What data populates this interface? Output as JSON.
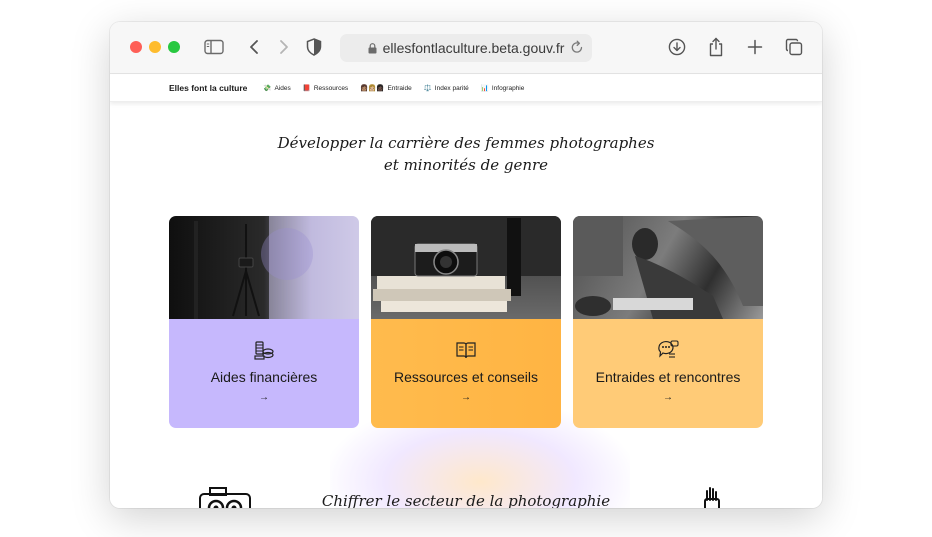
{
  "browser": {
    "url": "ellesfontlaculture.beta.gouv.fr",
    "icons": [
      "sidebar-icon",
      "back-icon",
      "forward-icon",
      "shield-icon",
      "lock-icon",
      "reload-icon",
      "download-icon",
      "share-icon",
      "new-tab-icon",
      "tabs-icon"
    ]
  },
  "nav": {
    "brand": "Elles font la culture",
    "items": [
      {
        "emoji": "💸",
        "label": "Aides"
      },
      {
        "emoji": "📕",
        "label": "Ressources"
      },
      {
        "emoji": "👩🏽👩🏼👩🏿",
        "label": "Entraide"
      },
      {
        "emoji": "⚖️",
        "label": "Index parité"
      },
      {
        "emoji": "📊",
        "label": "Infographie"
      }
    ]
  },
  "hero": {
    "line1": "Développer la carrière des femmes photographes",
    "line2": "et minorités de genre"
  },
  "cards": [
    {
      "title": "Aides financières",
      "arrow": "→",
      "icon": "coins-icon",
      "color": "#c6b8fd"
    },
    {
      "title": "Ressources et conseils",
      "arrow": "→",
      "icon": "book-icon",
      "color": "#ffb443"
    },
    {
      "title": "Entraides et rencontres",
      "arrow": "→",
      "icon": "chat-icon",
      "color": "#ffcb77"
    }
  ],
  "section2": {
    "title": "Chiffrer le secteur de la photographie"
  }
}
